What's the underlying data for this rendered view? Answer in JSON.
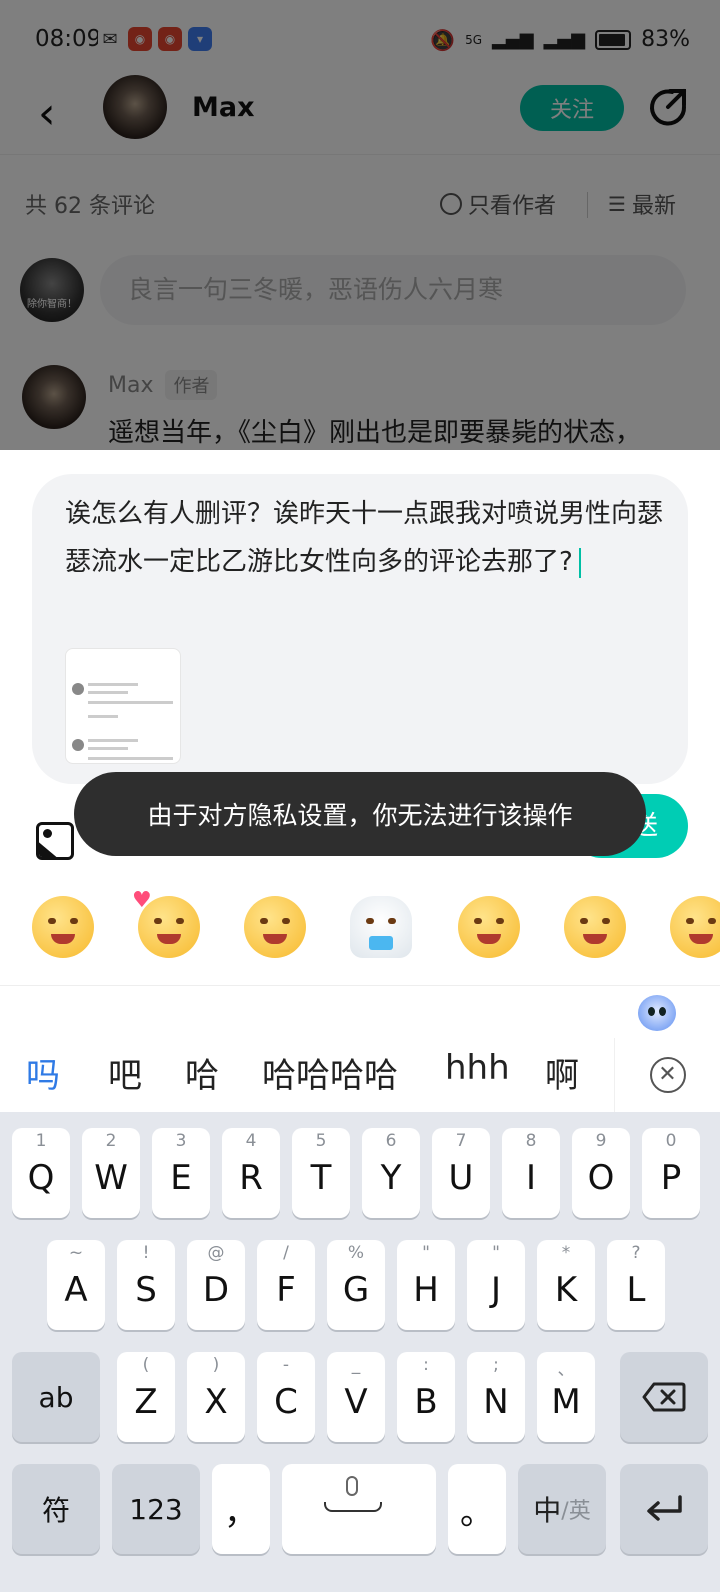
{
  "status_bar": {
    "time": "08:09",
    "battery": "83%",
    "network": "5G"
  },
  "nav": {
    "name": "Max",
    "follow_label": "关注"
  },
  "comments_header": {
    "count": "共 62 条评论",
    "only_author": "只看作者",
    "sort": "最新"
  },
  "comment_input": {
    "placeholder": "良言一句三冬暖，恶语伤人六月寒"
  },
  "my_avatar_text": "除你智商！",
  "comment": {
    "author": "Max",
    "tag": "作者",
    "text": "遥想当年，《尘白》刚出也是即要暴毙的状态，"
  },
  "reply": {
    "text": "诶怎么有人删评？诶昨天十一点跟我对喷说男性向瑟瑟流水一定比乙游比女性向多的评论去那了?"
  },
  "toast": {
    "text": "由于对方隐私设置，你无法进行该操作"
  },
  "send_label": "发送",
  "emojis": [
    "cry-emoji",
    "love-emoji",
    "angry-emoji",
    "seal-cry-emoji",
    "drool-emoji",
    "sleepy-emoji",
    "smug-emoji"
  ],
  "candidates": [
    "吗",
    "吧",
    "哈",
    "哈哈哈哈",
    "hhh",
    "啊"
  ],
  "keyboard": {
    "row1": [
      {
        "sub": "1",
        "main": "Q"
      },
      {
        "sub": "2",
        "main": "W"
      },
      {
        "sub": "3",
        "main": "E"
      },
      {
        "sub": "4",
        "main": "R"
      },
      {
        "sub": "5",
        "main": "T"
      },
      {
        "sub": "6",
        "main": "Y"
      },
      {
        "sub": "7",
        "main": "U"
      },
      {
        "sub": "8",
        "main": "I"
      },
      {
        "sub": "9",
        "main": "O"
      },
      {
        "sub": "0",
        "main": "P"
      }
    ],
    "row2": [
      {
        "sub": "~",
        "main": "A"
      },
      {
        "sub": "!",
        "main": "S"
      },
      {
        "sub": "@",
        "main": "D"
      },
      {
        "sub": "/",
        "main": "F"
      },
      {
        "sub": "%",
        "main": "G"
      },
      {
        "sub": "\"",
        "main": "H"
      },
      {
        "sub": "\"",
        "main": "J"
      },
      {
        "sub": "*",
        "main": "K"
      },
      {
        "sub": "?",
        "main": "L"
      }
    ],
    "row3": [
      {
        "sub": "(",
        "main": "Z"
      },
      {
        "sub": ")",
        "main": "X"
      },
      {
        "sub": "-",
        "main": "C"
      },
      {
        "sub": "_",
        "main": "V"
      },
      {
        "sub": ":",
        "main": "B"
      },
      {
        "sub": ";",
        "main": "N"
      },
      {
        "sub": "、",
        "main": "M"
      }
    ],
    "ab": "ab",
    "symbols": "符",
    "numbers": "123",
    "comma": "，",
    "period": "。",
    "lang_zh": "中",
    "lang_en": "/英"
  },
  "colors": {
    "accent": "#00bfa5",
    "toast_bg": "#2e2e2e",
    "candidate_active": "#2f7ae5"
  }
}
